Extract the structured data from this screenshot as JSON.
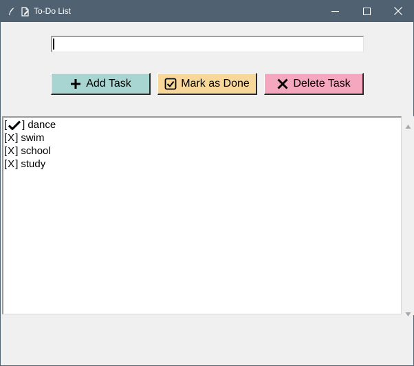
{
  "window": {
    "title": "To-Do List",
    "app_icon": "feather-icon",
    "doc_icon": "document-edit-icon",
    "titlebar_color": "#506271",
    "controls": [
      "minimize-icon",
      "maximize-icon",
      "close-icon"
    ]
  },
  "entry": {
    "value": "",
    "placeholder": ""
  },
  "buttons": {
    "add": {
      "label": "Add Task",
      "icon": "plus-icon",
      "color": "#a8d5d1"
    },
    "done": {
      "label": "Mark as Done",
      "icon": "checkbox-icon",
      "color": "#f8d89a"
    },
    "delete": {
      "label": "Delete Task",
      "icon": "x-icon",
      "color": "#f5a7c0"
    }
  },
  "tasks": [
    {
      "open": "[",
      "close": "]",
      "done": true,
      "status_icon": "checkmark-icon",
      "name": "dance"
    },
    {
      "open": "[",
      "close": "]",
      "done": false,
      "status_text": "X",
      "name": "swim"
    },
    {
      "open": "[",
      "close": "]",
      "done": false,
      "status_text": "X",
      "name": "school"
    },
    {
      "open": "[",
      "close": "]",
      "done": false,
      "status_text": "X",
      "name": "study"
    }
  ]
}
